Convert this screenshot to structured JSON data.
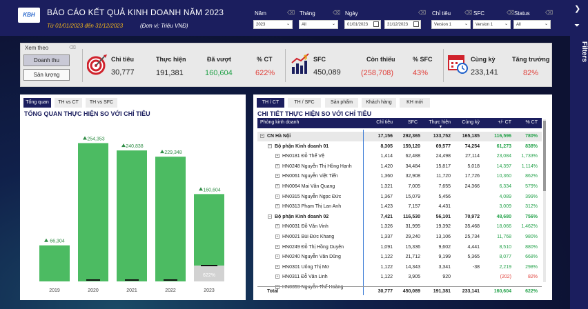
{
  "header": {
    "logo": "KBH",
    "title": "BÁO CÁO KẾT QUẢ KINH DOANH NĂM 2023",
    "period": "Từ 01/01/2023 đến 31/12/2023",
    "unit": "(Đơn vị: Triệu VNĐ)"
  },
  "filters": {
    "year": {
      "label": "Năm",
      "value": "2023"
    },
    "month": {
      "label": "Tháng",
      "value": "All"
    },
    "date": {
      "label": "Ngày",
      "from": "01/01/2023",
      "to": "31/12/2023"
    },
    "target": {
      "label": "Chỉ tiêu",
      "value": "Version 1"
    },
    "sfc": {
      "label": "SFC",
      "value": "Version 1"
    },
    "status": {
      "label": "Status",
      "value": "All"
    }
  },
  "filter_pane": {
    "title": "Filters"
  },
  "kpi": {
    "view_label": "Xem theo",
    "btn_revenue": "Doanh thu",
    "btn_volume": "Sản lượng",
    "target_label": "Chỉ tiêu",
    "target_value": "30,777",
    "actual_label": "Thực hiện",
    "actual_value": "191,381",
    "over_label": "Đã vượt",
    "over_value": "160,604",
    "pct_label": "% CT",
    "pct_value": "622%",
    "sfc_label": "SFC",
    "sfc_value": "450,089",
    "remain_label": "Còn thiếu",
    "remain_value": "(258,708)",
    "pct_sfc_label": "% SFC",
    "pct_sfc_value": "43%",
    "ly_label": "Cùng kỳ",
    "ly_value": "233,141",
    "growth_label": "Tăng trưởng",
    "growth_value": "82%"
  },
  "left": {
    "tabs": [
      "Tổng quan",
      "TH vs CT",
      "TH vs SFC"
    ],
    "title": "TỔNG QUAN THỰC HIỆN SO VỚI CHỈ TIÊU"
  },
  "chart_data": {
    "type": "bar",
    "categories": [
      "2019",
      "2020",
      "2021",
      "2022",
      "2023"
    ],
    "values": [
      66304,
      254353,
      240838,
      229348,
      160604
    ],
    "value_labels": [
      "66,304",
      "254,353",
      "240,838",
      "229,348",
      "160,604"
    ],
    "annotation_2023": "622%",
    "title": "TỔNG QUAN THỰC HIỆN SO VỚI CHỈ TIÊU",
    "bar_color": "#4cbb62",
    "target_color": "#d2d2d2"
  },
  "right": {
    "tabs": [
      "TH / CT",
      "TH / SFC",
      "Sản phẩm",
      "Khách hàng",
      "KH mới"
    ],
    "title": "CHI TIẾT THỰC HIỆN SO VỚI CHỈ TIÊU",
    "columns": [
      "Phòng kinh doanh",
      "Chỉ tiêu",
      "SFC",
      "Thực hiện",
      "Cùng kỳ",
      "+/- CT",
      "% CT"
    ],
    "rows": [
      {
        "lvl": 0,
        "name": "CN Hà Nội",
        "ct": "17,156",
        "sfc": "292,365",
        "th": "133,752",
        "ck": "165,185",
        "diff": "116,596",
        "pct": "780%"
      },
      {
        "lvl": 1,
        "name": "Bộ phận Kinh doanh 01",
        "ct": "8,305",
        "sfc": "159,120",
        "th": "69,577",
        "ck": "74,254",
        "diff": "61,273",
        "pct": "838%"
      },
      {
        "lvl": 2,
        "name": "HN0181 Đỗ Thế Vệ",
        "ct": "1,414",
        "sfc": "62,488",
        "th": "24,498",
        "ck": "27,114",
        "diff": "23,084",
        "pct": "1,733%"
      },
      {
        "lvl": 2,
        "name": "HN0248 Nguyễn Thị Hồng Hạnh",
        "ct": "1,420",
        "sfc": "34,484",
        "th": "15,817",
        "ck": "5,018",
        "diff": "14,397",
        "pct": "1,114%"
      },
      {
        "lvl": 2,
        "name": "HN0061 Nguyễn Việt Tiến",
        "ct": "1,360",
        "sfc": "32,908",
        "th": "11,720",
        "ck": "17,726",
        "diff": "10,360",
        "pct": "862%"
      },
      {
        "lvl": 2,
        "name": "HN0064 Mai Văn Quang",
        "ct": "1,321",
        "sfc": "7,005",
        "th": "7,655",
        "ck": "24,366",
        "diff": "6,334",
        "pct": "579%"
      },
      {
        "lvl": 2,
        "name": "HN0315 Nguyễn Ngọc Đức",
        "ct": "1,367",
        "sfc": "15,079",
        "th": "5,456",
        "ck": "",
        "diff": "4,089",
        "pct": "399%"
      },
      {
        "lvl": 2,
        "name": "HN0313 Phạm Thị Lan Anh",
        "ct": "1,423",
        "sfc": "7,157",
        "th": "4,431",
        "ck": "",
        "diff": "3,009",
        "pct": "312%"
      },
      {
        "lvl": 1,
        "name": "Bộ phận Kinh doanh 02",
        "ct": "7,421",
        "sfc": "116,530",
        "th": "56,101",
        "ck": "70,972",
        "diff": "48,680",
        "pct": "756%"
      },
      {
        "lvl": 2,
        "name": "HN0031 Đỗ Văn Vinh",
        "ct": "1,326",
        "sfc": "31,995",
        "th": "19,392",
        "ck": "35,468",
        "diff": "18,066",
        "pct": "1,462%"
      },
      {
        "lvl": 2,
        "name": "HN0021 Bùi Đức Khang",
        "ct": "1,337",
        "sfc": "29,240",
        "th": "13,106",
        "ck": "25,734",
        "diff": "11,768",
        "pct": "980%"
      },
      {
        "lvl": 2,
        "name": "HN0249 Đỗ Thị Hồng Duyên",
        "ct": "1,091",
        "sfc": "15,336",
        "th": "9,602",
        "ck": "4,441",
        "diff": "8,510",
        "pct": "880%"
      },
      {
        "lvl": 2,
        "name": "HN0240 Nguyễn Văn Dũng",
        "ct": "1,122",
        "sfc": "21,712",
        "th": "9,199",
        "ck": "5,365",
        "diff": "8,077",
        "pct": "668%"
      },
      {
        "lvl": 2,
        "name": "HN0301 Uông Thị Mơ",
        "ct": "1,122",
        "sfc": "14,343",
        "th": "3,341",
        "ck": "-38",
        "diff": "2,219",
        "pct": "298%"
      },
      {
        "lvl": 2,
        "name": "HN0311 Đỗ Văn Linh",
        "ct": "1,122",
        "sfc": "3,905",
        "th": "920",
        "ck": "",
        "diff": "(202)",
        "pct": "82%"
      },
      {
        "lvl": 2,
        "name": "HN0359 Nguyễn Thế Hoàng",
        "ct": "",
        "sfc": "",
        "th": "",
        "ck": "",
        "diff": "",
        "pct": ""
      }
    ],
    "total": {
      "name": "Total",
      "ct": "30,777",
      "sfc": "450,089",
      "th": "191,381",
      "ck": "233,141",
      "diff": "160,604",
      "pct": "622%"
    }
  }
}
